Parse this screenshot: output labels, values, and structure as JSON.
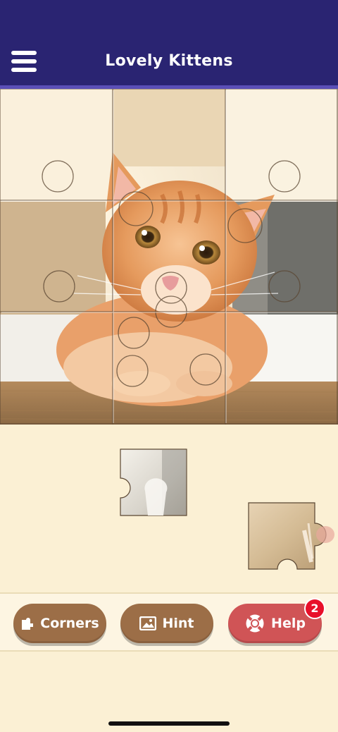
{
  "app": {
    "title": "Lovely Kittens"
  },
  "colors": {
    "header": "#2a2472",
    "header_accent": "#5b4fb7",
    "background": "#fbf0d4",
    "button_brown": "#9c6e47",
    "button_help": "#d05456",
    "badge": "#e8102a"
  },
  "header": {
    "menu_icon": "hamburger-menu-icon"
  },
  "puzzle": {
    "rows": 3,
    "columns": 3,
    "placed_pieces": 9,
    "loose_pieces": 2
  },
  "toolbar": {
    "corners_label": "Corners",
    "corners_icon": "corner-piece-icon",
    "hint_label": "Hint",
    "hint_icon": "image-icon",
    "help_label": "Help",
    "help_icon": "lifebuoy-icon",
    "help_badge": "2"
  }
}
